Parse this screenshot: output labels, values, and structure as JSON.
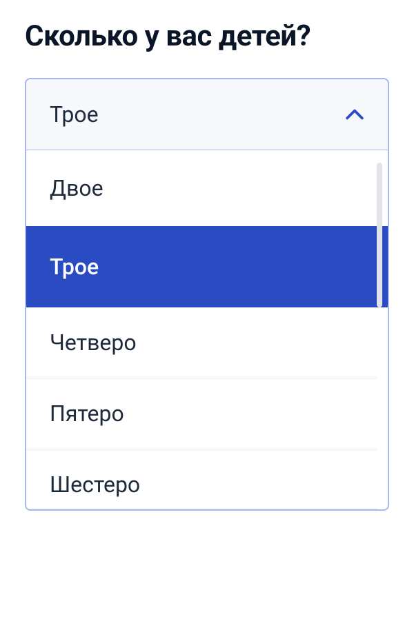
{
  "title": "Сколько у вас детей?",
  "dropdown": {
    "selected_label": "Трое",
    "options": {
      "0": "Двое",
      "1": "Трое",
      "2": "Четверо",
      "3": "Пятеро",
      "4": "Шестеро"
    },
    "selected_index": 1
  },
  "colors": {
    "accent": "#2b4bc2",
    "border": "#a7b8ea",
    "text": "#1e2a3a",
    "header_bg": "#f6f8fc"
  }
}
